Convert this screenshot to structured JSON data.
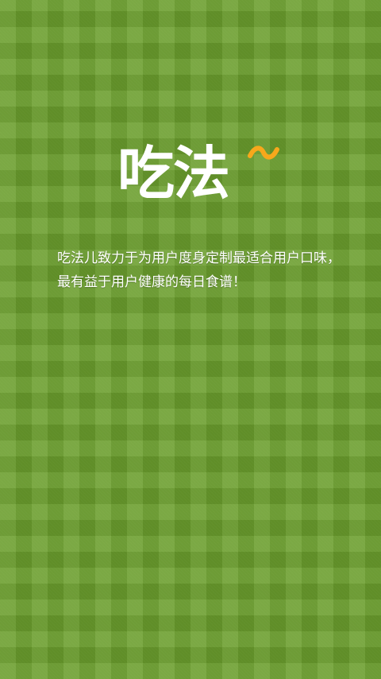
{
  "app": {
    "logo_text": "吃法",
    "accent_color": "#f7a81b",
    "background_color": "#6a9e2c"
  },
  "splash": {
    "tagline": "吃法儿致力于为用户度身定制最适合用户口味，最有益于用户健康的每日食谱！"
  }
}
